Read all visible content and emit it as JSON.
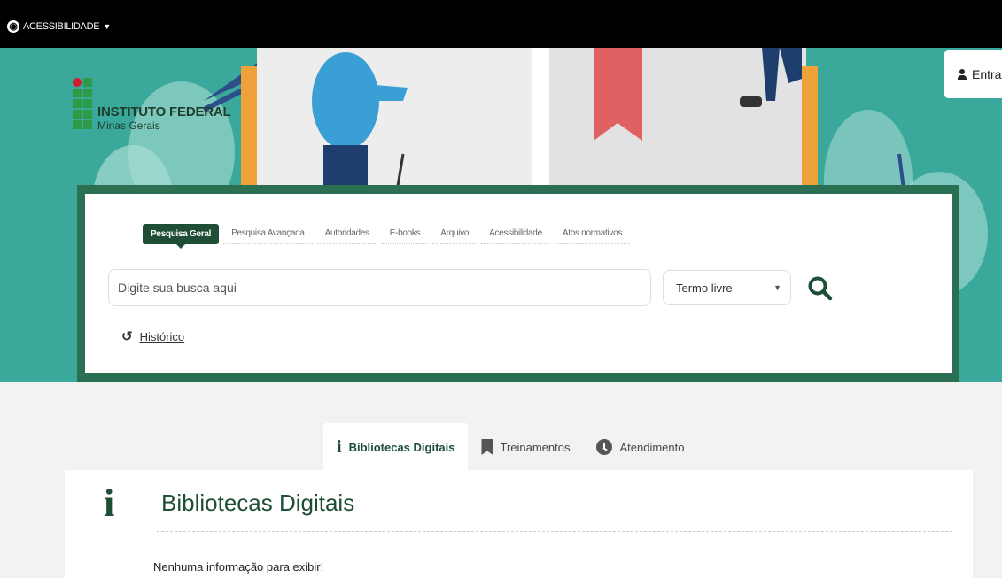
{
  "topbar": {
    "accessibility_label": "ACESSIBILIDADE"
  },
  "header": {
    "logo_title": "INSTITUTO FEDERAL",
    "logo_subtitle": "Minas Gerais",
    "login_label": "Entra"
  },
  "search": {
    "tabs": [
      {
        "label": "Pesquisa Geral",
        "active": true
      },
      {
        "label": "Pesquisa Avançada"
      },
      {
        "label": "Autoridades"
      },
      {
        "label": "E-books"
      },
      {
        "label": "Arquivo"
      },
      {
        "label": "Acessibilidade"
      },
      {
        "label": "Atos normativos"
      }
    ],
    "placeholder": "Digite sua busca aqui",
    "type_selected": "Termo livre",
    "history_label": "Histórico"
  },
  "section_tabs": [
    {
      "label": "Bibliotecas Digitais",
      "icon": "info-icon",
      "active": true
    },
    {
      "label": "Treinamentos",
      "icon": "bookmark-icon"
    },
    {
      "label": "Atendimento",
      "icon": "clock-icon"
    }
  ],
  "content": {
    "title": "Bibliotecas Digitais",
    "empty_message": "Nenhuma informação para exibir!"
  },
  "colors": {
    "brand_dark_green": "#1e4e35",
    "hero_teal": "#3aa89b",
    "logo_green": "#2d9a47",
    "logo_red": "#d01e2b"
  }
}
